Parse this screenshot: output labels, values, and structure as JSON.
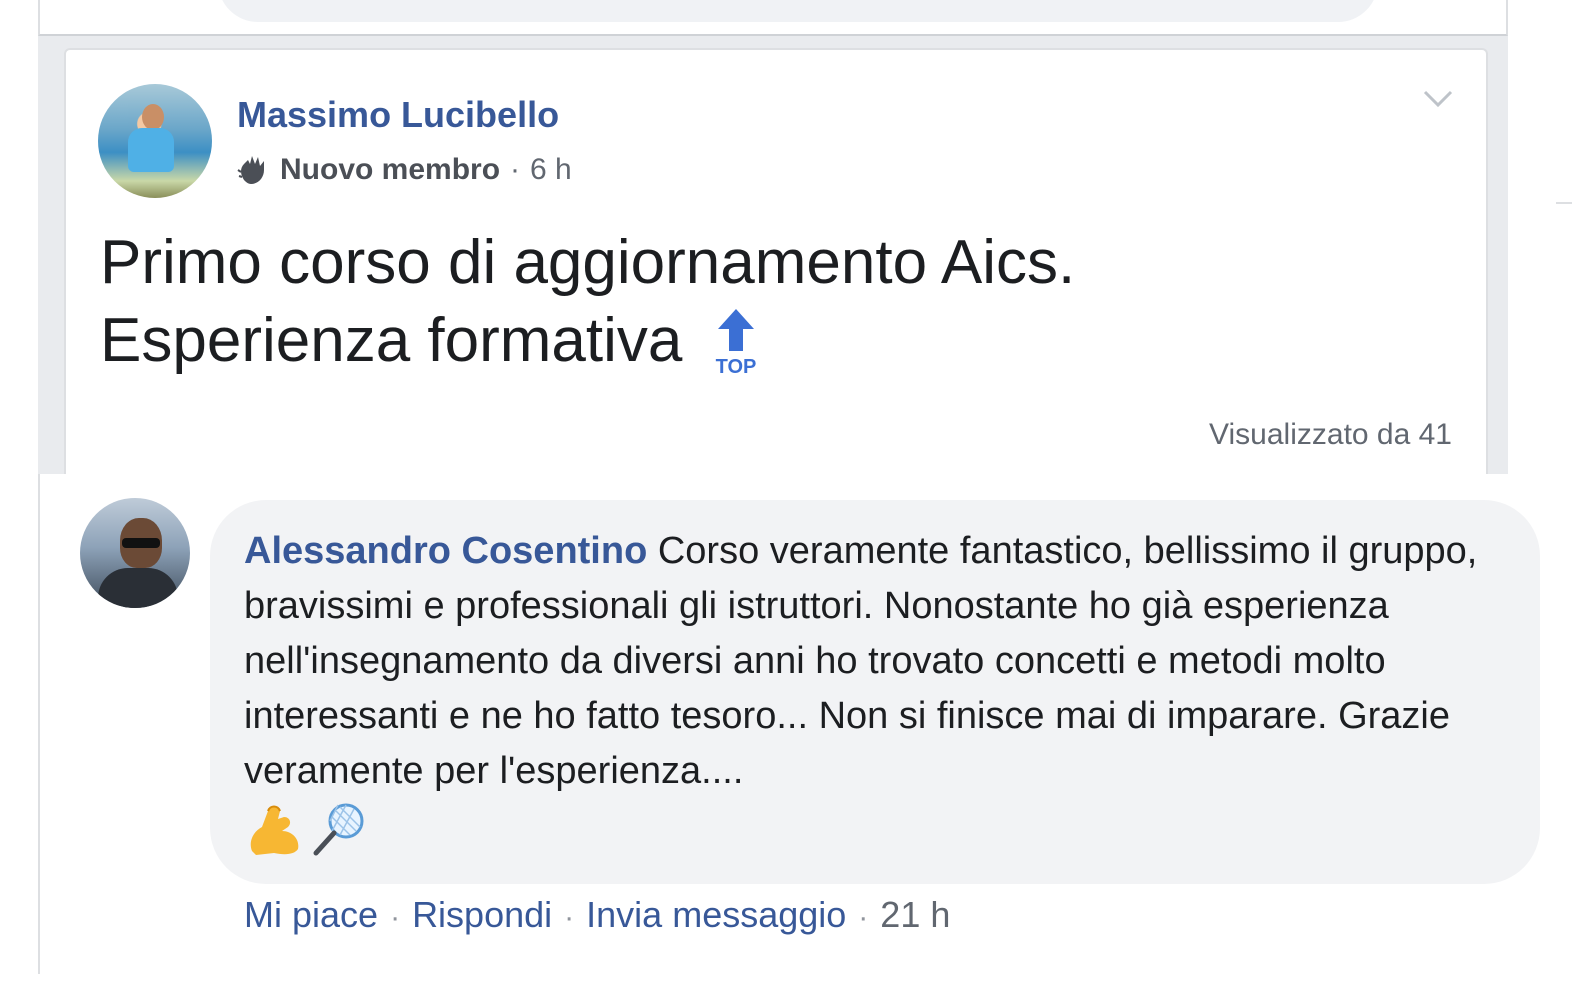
{
  "post": {
    "author_name": "Massimo Lucibello",
    "badge": "Nuovo membro",
    "separator": "·",
    "time": "6 h",
    "text_line1": "Primo corso di aggiornamento Aics.",
    "text_line2": "Esperienza formativa",
    "top_emoji_label": "TOP",
    "views": "Visualizzato da 41"
  },
  "comment": {
    "author_name": "Alessandro Cosentino",
    "text": "Corso veramente fantastico, bellissimo il gruppo, bravissimi e professionali gli istruttori. Nonostante ho già esperienza nell'insegnamento da diversi anni ho trovato concetti e metodi molto interessanti e ne ho fatto tesoro... Non si finisce mai di imparare. Grazie veramente per l'esperienza....",
    "emojis": [
      "flexed-biceps-icon",
      "tennis-racket-icon"
    ],
    "actions": {
      "like": "Mi piace",
      "reply": "Rispondi",
      "message": "Invia messaggio",
      "time": "21 h",
      "separator": "·"
    }
  },
  "colors": {
    "link_blue": "#385898",
    "meta_gray": "#616770",
    "bubble_bg": "#f2f3f5",
    "feed_bg": "#e9ebee"
  }
}
